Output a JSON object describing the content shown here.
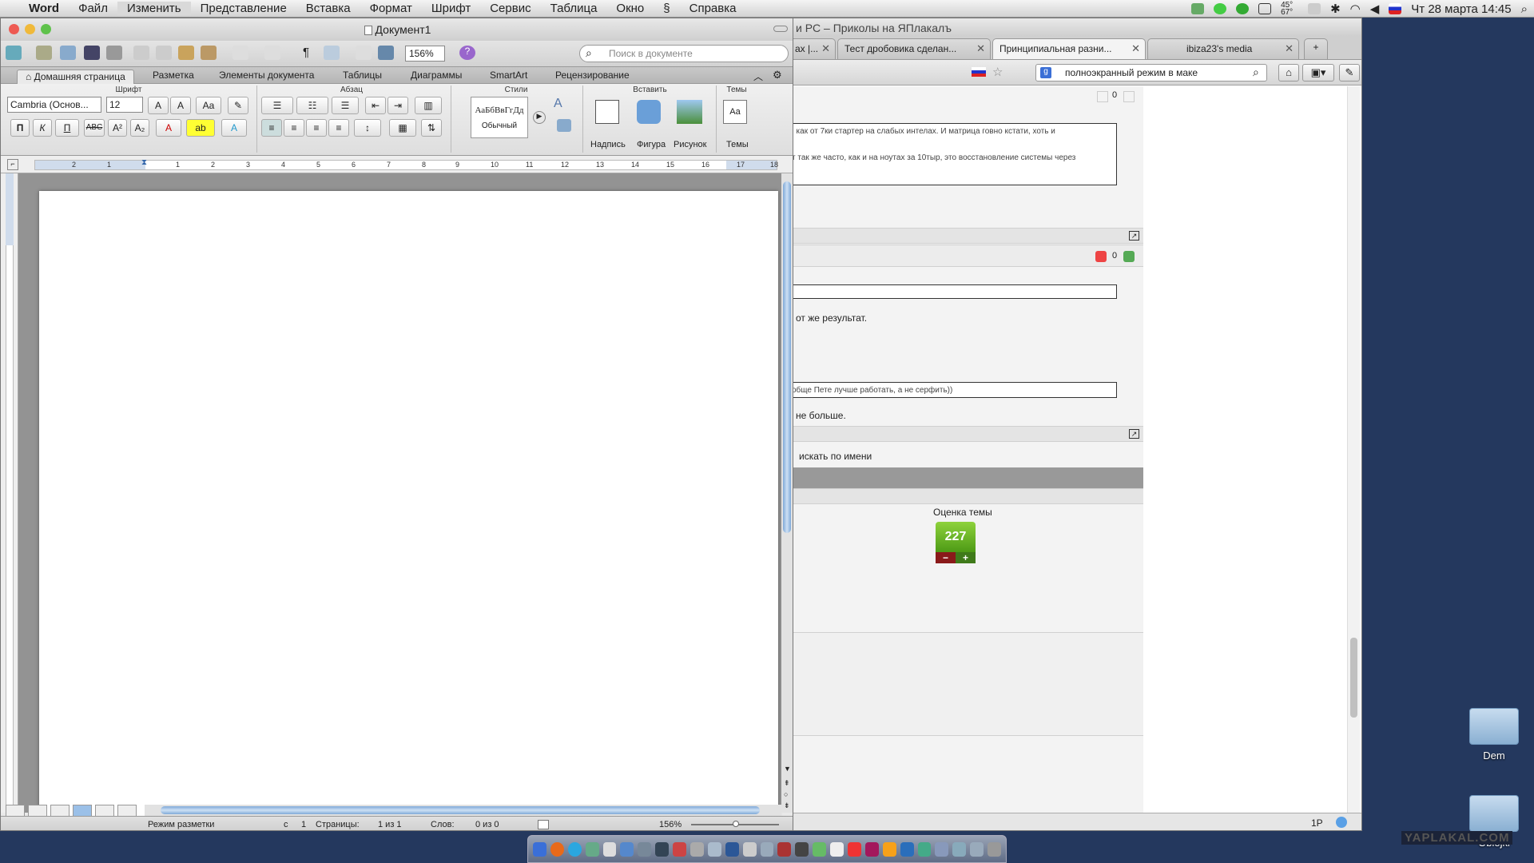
{
  "menubar": {
    "app": "Word",
    "items": [
      "Файл",
      "Изменить",
      "Представление",
      "Вставка",
      "Формат",
      "Шрифт",
      "Сервис",
      "Таблица",
      "Окно",
      "Справка"
    ],
    "clock": "Чт 28 марта  14:45",
    "temp": "45° 67°"
  },
  "browser": {
    "title": "и PC – Приколы на ЯПлакалъ",
    "tabs": [
      "ах |...",
      "Тест дробовика сделан...",
      "Принципиальная разни...",
      "ibiza23's media"
    ],
    "search_value": "полноэкранный режим в маке",
    "forum": {
      "post1_line1": ", как от 7ки стартер на слабых интелах. И матрица говно кстати, хоть и",
      "post1_line2": "т так же часто, как и на ноутах за 10тыр, это восстановление системы через",
      "count1": "0",
      "count2": "0",
      "text1": "от же результат.",
      "quote2": "обще Пете лучше работать, а не серфить))",
      "text2": "не больше.",
      "search_name": "искать по имени",
      "rating_label": "Оценка темы",
      "rating_value": "227",
      "minus": "−",
      "plus": "+"
    },
    "status_right": "1P"
  },
  "desktop": {
    "icons": [
      "Dem",
      "Oblojki"
    ],
    "watermark": "YAPLAKAL.COM"
  },
  "word": {
    "title": "Документ1",
    "zoom": "156%",
    "search_placeholder": "Поиск в документе",
    "ribbon_tabs": [
      "Домашняя страница",
      "Разметка",
      "Элементы документа",
      "Таблицы",
      "Диаграммы",
      "SmartArt",
      "Рецензирование"
    ],
    "groups": {
      "font": "Шрифт",
      "paragraph": "Абзац",
      "styles": "Стили",
      "insert": "Вставить",
      "themes": "Темы"
    },
    "font_name": "Cambria (Основ...",
    "font_size": "12",
    "style_sample": "АаБбВвГгДд",
    "style_name": "Обычный",
    "insert_buttons": [
      "Надпись",
      "Фигура",
      "Рисунок"
    ],
    "themes_button": "Темы",
    "bold": "П",
    "italic": "К",
    "underline": "П",
    "ruler_numbers": [
      "2",
      "1",
      "1",
      "2",
      "3",
      "4",
      "5",
      "6",
      "7",
      "8",
      "9",
      "10",
      "11",
      "12",
      "13",
      "14",
      "15",
      "16",
      "17",
      "18"
    ],
    "status": {
      "mode": "Режим разметки",
      "section_label": "с",
      "section_value": "1",
      "pages_label": "Страницы:",
      "pages_value": "1 из 1",
      "words_label": "Слов:",
      "words_value": "0 из 0",
      "zoom": "156%"
    }
  },
  "colors": {
    "desktop": "#24385e",
    "rating_green": "#5aa81d",
    "rating_minus": "#8a1a1a",
    "scroll_blue": "#7fa9d8"
  }
}
